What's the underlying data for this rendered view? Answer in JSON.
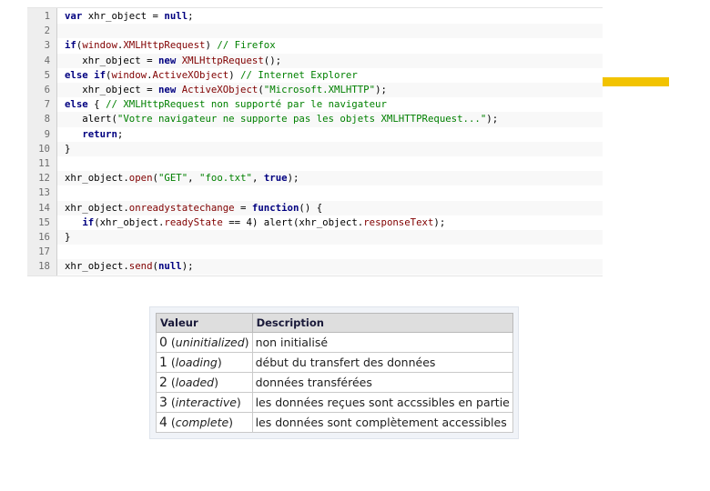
{
  "code": {
    "lines": [
      {
        "n": "1",
        "tokens": [
          [
            "kw",
            "var"
          ],
          [
            "pln",
            " xhr_object = "
          ],
          [
            "kw",
            "null"
          ],
          [
            "pln",
            ";"
          ]
        ]
      },
      {
        "n": "2",
        "tokens": []
      },
      {
        "n": "3",
        "tokens": [
          [
            "kw",
            "if"
          ],
          [
            "pln",
            "("
          ],
          [
            "obj",
            "window"
          ],
          [
            "pln",
            "."
          ],
          [
            "obj",
            "XMLHttpRequest"
          ],
          [
            "pln",
            ") "
          ],
          [
            "cmt",
            "// Firefox"
          ]
        ]
      },
      {
        "n": "4",
        "tokens": [
          [
            "pln",
            "   xhr_object = "
          ],
          [
            "kw",
            "new"
          ],
          [
            "pln",
            " "
          ],
          [
            "obj",
            "XMLHttpRequest"
          ],
          [
            "pln",
            "();"
          ]
        ]
      },
      {
        "n": "5",
        "tokens": [
          [
            "kw",
            "else if"
          ],
          [
            "pln",
            "("
          ],
          [
            "obj",
            "window"
          ],
          [
            "pln",
            "."
          ],
          [
            "obj",
            "ActiveXObject"
          ],
          [
            "pln",
            ") "
          ],
          [
            "cmt",
            "// Internet Explorer"
          ]
        ]
      },
      {
        "n": "6",
        "tokens": [
          [
            "pln",
            "   xhr_object = "
          ],
          [
            "kw",
            "new"
          ],
          [
            "pln",
            " "
          ],
          [
            "obj",
            "ActiveXObject"
          ],
          [
            "pln",
            "("
          ],
          [
            "str",
            "\"Microsoft.XMLHTTP\""
          ],
          [
            "pln",
            ");"
          ]
        ]
      },
      {
        "n": "7",
        "tokens": [
          [
            "kw",
            "else"
          ],
          [
            "pln",
            " { "
          ],
          [
            "cmt",
            "// XMLHttpRequest non supporté par le navigateur"
          ]
        ]
      },
      {
        "n": "8",
        "tokens": [
          [
            "pln",
            "   alert("
          ],
          [
            "str",
            "\"Votre navigateur ne supporte pas les objets XMLHTTPRequest...\""
          ],
          [
            "pln",
            ");"
          ]
        ]
      },
      {
        "n": "9",
        "tokens": [
          [
            "pln",
            "   "
          ],
          [
            "kw",
            "return"
          ],
          [
            "pln",
            ";"
          ]
        ]
      },
      {
        "n": "10",
        "tokens": [
          [
            "pln",
            "}"
          ]
        ]
      },
      {
        "n": "11",
        "tokens": []
      },
      {
        "n": "12",
        "tokens": [
          [
            "pln",
            "xhr_object."
          ],
          [
            "obj",
            "open"
          ],
          [
            "pln",
            "("
          ],
          [
            "str",
            "\"GET\""
          ],
          [
            "pln",
            ", "
          ],
          [
            "str",
            "\"foo.txt\""
          ],
          [
            "pln",
            ", "
          ],
          [
            "kw",
            "true"
          ],
          [
            "pln",
            ");"
          ]
        ]
      },
      {
        "n": "13",
        "tokens": []
      },
      {
        "n": "14",
        "tokens": [
          [
            "pln",
            "xhr_object."
          ],
          [
            "obj",
            "onreadystatechange"
          ],
          [
            "pln",
            " = "
          ],
          [
            "kw",
            "function"
          ],
          [
            "pln",
            "() {"
          ]
        ]
      },
      {
        "n": "15",
        "tokens": [
          [
            "pln",
            "   "
          ],
          [
            "kw",
            "if"
          ],
          [
            "pln",
            "(xhr_object."
          ],
          [
            "obj",
            "readyState"
          ],
          [
            "pln",
            " == 4) alert(xhr_object."
          ],
          [
            "obj",
            "responseText"
          ],
          [
            "pln",
            ");"
          ]
        ]
      },
      {
        "n": "16",
        "tokens": [
          [
            "pln",
            "}"
          ]
        ]
      },
      {
        "n": "17",
        "tokens": []
      },
      {
        "n": "18",
        "tokens": [
          [
            "pln",
            "xhr_object."
          ],
          [
            "obj",
            "send"
          ],
          [
            "pln",
            "("
          ],
          [
            "kw",
            "null"
          ],
          [
            "pln",
            ");"
          ]
        ]
      }
    ]
  },
  "colors": {
    "accent": "#f2c300",
    "keyword": "#000080",
    "object": "#800000",
    "string": "#008000",
    "comment": "#008000"
  },
  "ready_state_table": {
    "headers": [
      "Valeur",
      "Description"
    ],
    "rows": [
      {
        "num": "0",
        "name": "uninitialized",
        "desc": "non initialisé"
      },
      {
        "num": "1",
        "name": "loading",
        "desc": "début du transfert des données"
      },
      {
        "num": "2",
        "name": "loaded",
        "desc": "données transférées"
      },
      {
        "num": "3",
        "name": "interactive",
        "desc": "les données reçues sont accssibles en partie"
      },
      {
        "num": "4",
        "name": "complete",
        "desc": "les données sont complètement accessibles"
      }
    ]
  }
}
